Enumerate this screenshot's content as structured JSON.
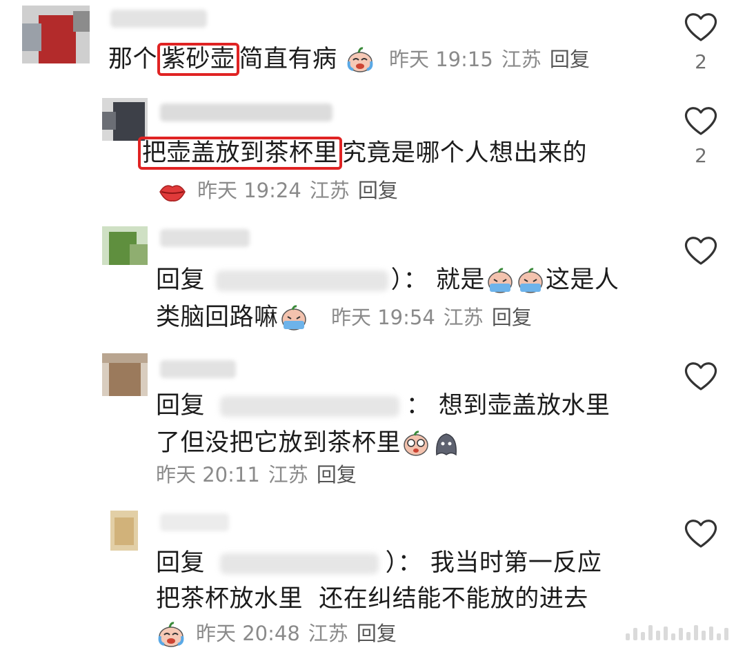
{
  "comments": [
    {
      "pre": "那个",
      "highlight": "紫砂壶",
      "post": "简直有病",
      "time": "昨天 19:15",
      "location": "江苏",
      "reply_label": "回复",
      "likes": "2"
    },
    {
      "highlight": "把壶盖放到茶杯里",
      "post": "究竟是哪个人想出来的",
      "time": "昨天 19:24",
      "location": "江苏",
      "reply_label": "回复",
      "likes": "2"
    },
    {
      "prefix": "回复",
      "suffix": "）：",
      "line1_text": "就是",
      "line1_tail": "这是人",
      "line2_text": "类脑回路嘛",
      "time": "昨天 19:54",
      "location": "江苏",
      "reply_label": "回复"
    },
    {
      "prefix": "回复",
      "suffix": "：",
      "line1_text": "想到壶盖放水里",
      "line2_text": "了但没把它放到茶杯里",
      "time": "昨天 20:11",
      "location": "江苏",
      "reply_label": "回复"
    },
    {
      "prefix": "回复",
      "suffix": "）：",
      "line1_text": "我当时第一反应",
      "line2_text": "把茶杯放水里  还在纠结能不能放的进去",
      "time": "昨天 20:48",
      "location": "江苏",
      "reply_label": "回复"
    }
  ],
  "icons": {
    "like": "heart-outline-icon",
    "emoji_laugh_cry": "laugh-cry-emoji",
    "emoji_lips": "lips-emoji",
    "emoji_crying": "crying-emoji",
    "emoji_shocked": "shocked-emoji",
    "emoji_ghost": "ghost-emoji"
  },
  "colors": {
    "highlight_border": "#e02323",
    "meta_text": "#8a8a8a",
    "body_text": "#1c1c1c"
  }
}
